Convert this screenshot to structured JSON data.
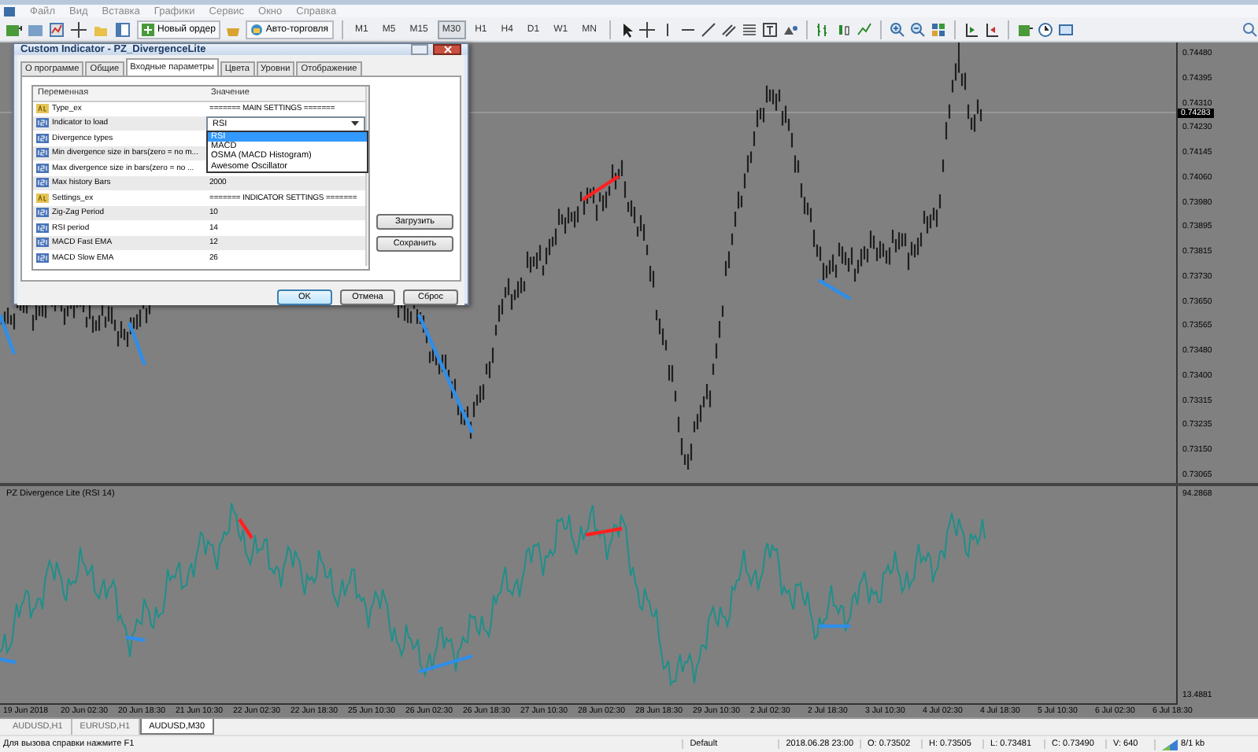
{
  "menu": [
    "Файл",
    "Вид",
    "Вставка",
    "Графики",
    "Сервис",
    "Окно",
    "Справка"
  ],
  "toolbar": {
    "buttons": [
      "Новый ордер",
      "Авто-торговля"
    ],
    "timeframes": [
      {
        "label": "M1",
        "selected": false
      },
      {
        "label": "M5",
        "selected": false
      },
      {
        "label": "M15",
        "selected": false
      },
      {
        "label": "M30",
        "selected": true
      },
      {
        "label": "H1",
        "selected": false
      },
      {
        "label": "H4",
        "selected": false
      },
      {
        "label": "D1",
        "selected": false
      },
      {
        "label": "W1",
        "selected": false
      },
      {
        "label": "MN",
        "selected": false
      }
    ]
  },
  "chart": {
    "price_axis": [
      "0.74480",
      "0.74395",
      "0.74310",
      "0.74230",
      "0.74145",
      "0.74060",
      "0.73980",
      "0.73895",
      "0.73815",
      "0.73730",
      "0.73650",
      "0.73565",
      "0.73480",
      "0.73400",
      "0.73315",
      "0.73235",
      "0.73150",
      "0.73065"
    ],
    "current_price": "0.74283",
    "indicator_label": "PZ Divergence Lite (RSI 14)",
    "indicator_axis": [
      "94.2868",
      "13.4881"
    ],
    "time_axis": [
      "19 Jun 2018",
      "20 Jun 02:30",
      "20 Jun 18:30",
      "21 Jun 10:30",
      "22 Jun 02:30",
      "22 Jun 18:30",
      "25 Jun 10:30",
      "26 Jun 02:30",
      "26 Jun 18:30",
      "27 Jun 10:30",
      "28 Jun 02:30",
      "28 Jun 18:30",
      "29 Jun 10:30",
      "2 Jul 02:30",
      "2 Jul 18:30",
      "3 Jul 10:30",
      "4 Jul 02:30",
      "4 Jul 18:30",
      "5 Jul 10:30",
      "6 Jul 02:30",
      "6 Jul 18:30"
    ]
  },
  "dialog": {
    "title": "Custom Indicator - PZ_DivergenceLite",
    "tabs": [
      {
        "label": "О программе",
        "selected": false
      },
      {
        "label": "Общие",
        "selected": false
      },
      {
        "label": "Входные параметры",
        "selected": true
      },
      {
        "label": "Цвета",
        "selected": false
      },
      {
        "label": "Уровни",
        "selected": false
      },
      {
        "label": "Отображение",
        "selected": false
      }
    ],
    "columns": [
      "Переменная",
      "Значение"
    ],
    "rows": [
      {
        "kind": "text",
        "name": "Type_ex",
        "value": "======= MAIN SETTINGS ======="
      },
      {
        "kind": "number",
        "name": "Indicator to load",
        "value": "RSI",
        "dropdown": true
      },
      {
        "kind": "number",
        "name": "Divergence types"
      },
      {
        "kind": "number",
        "name": "Min divergence size in bars(zero = no m..."
      },
      {
        "kind": "number",
        "name": "Max divergence size in bars(zero = no ..."
      },
      {
        "kind": "number",
        "name": "Max history Bars",
        "value": "2000"
      },
      {
        "kind": "text",
        "name": "Settings_ex",
        "value": "======= INDICATOR SETTINGS ======="
      },
      {
        "kind": "number",
        "name": "Zig-Zag Period",
        "value": "10"
      },
      {
        "kind": "number",
        "name": "RSI period",
        "value": "14"
      },
      {
        "kind": "number",
        "name": "MACD Fast EMA",
        "value": "12"
      },
      {
        "kind": "number",
        "name": "MACD Slow EMA",
        "value": "26"
      }
    ],
    "dropdown_options": [
      {
        "label": "RSI",
        "selected": true
      },
      {
        "label": "MACD",
        "selected": false
      },
      {
        "label": "OSMA (MACD Histogram)",
        "selected": false
      },
      {
        "label": "Awesome Oscillator",
        "selected": false
      }
    ],
    "side_buttons": [
      "Загрузить",
      "Сохранить"
    ],
    "buttons": [
      "OK",
      "Отмена",
      "Сброс"
    ]
  },
  "chart_tabs": [
    {
      "label": "AUDUSD,H1",
      "selected": false
    },
    {
      "label": "EURUSD,H1",
      "selected": false
    },
    {
      "label": "AUDUSD,M30",
      "selected": true
    }
  ],
  "status_bar": {
    "hint": "Для вызова справки нажмите F1",
    "profile": "Default",
    "time": "2018.06.28 23:00",
    "open": "O: 0.73502",
    "high": "H: 0.73505",
    "low": "L: 0.73481",
    "close": "C: 0.73490",
    "volume": "V: 640",
    "traffic": "8/1 kb"
  }
}
